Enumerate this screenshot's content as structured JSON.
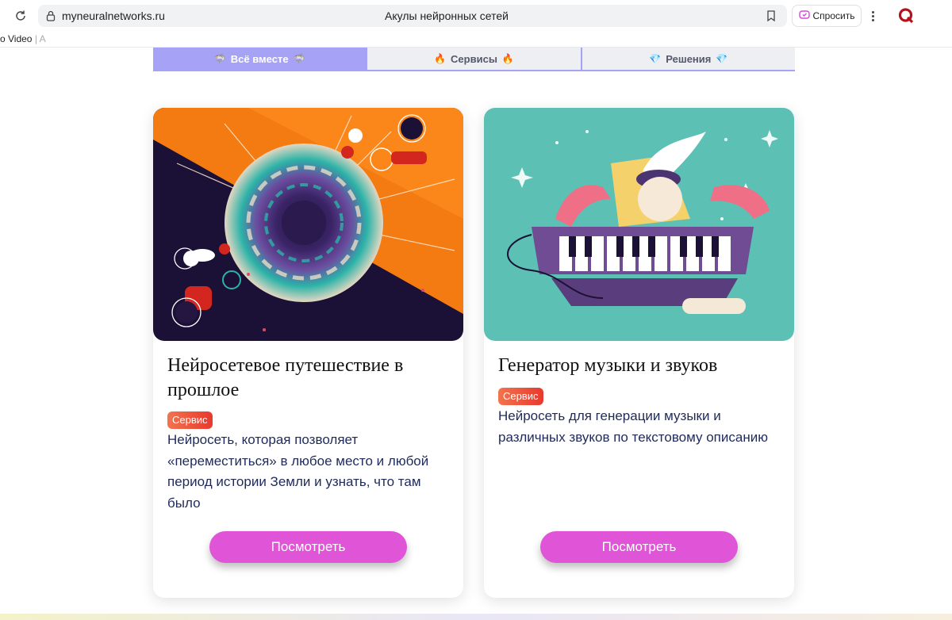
{
  "browser": {
    "url": "myneuralnetworks.ru",
    "page_title": "Акулы нейронных сетей",
    "ask_label": "Спросить",
    "profile_letter": "Q",
    "bookmarks_text": "o Video",
    "bookmarks_sep": " | A"
  },
  "tabs": [
    {
      "label": "Всё вместе",
      "emoji": "🦈",
      "active": true
    },
    {
      "label": "Сервисы",
      "emoji": "🔥",
      "active": false
    },
    {
      "label": "Решения",
      "emoji": "💎",
      "active": false
    }
  ],
  "cards": [
    {
      "title": "Нейросетевое путешествие в прошлое",
      "badge": "Сервис",
      "description": "Нейросеть, которая позволяет «переместиться» в любое место и любой период истории Земли и узнать, что там было",
      "button": "Посмотреть"
    },
    {
      "title": "Генератор музыки и звуков",
      "badge": "Сервис",
      "description": "Нейросеть для генерации музыки и различных звуков по текстовому описанию",
      "button": "Посмотреть"
    }
  ],
  "colors": {
    "tab_active": "#a6a2f5",
    "badge": "#e8392e",
    "button": "#e055d8",
    "desc_text": "#1f2a5a"
  }
}
